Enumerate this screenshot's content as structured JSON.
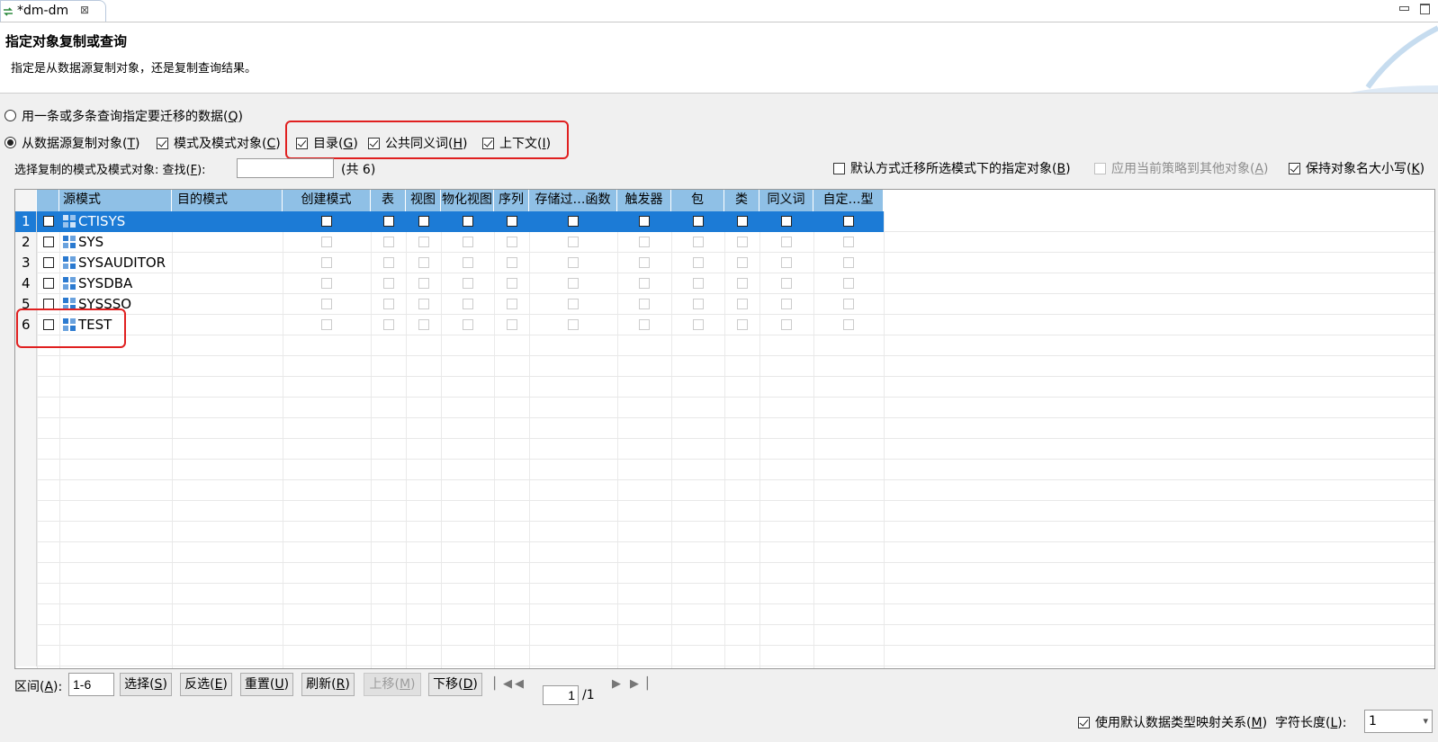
{
  "tab": {
    "title": "*dm-dm",
    "close_glyph": "⊠"
  },
  "header": {
    "title": "指定对象复制或查询",
    "description": "指定是从数据源复制对象，还是复制查询结果。"
  },
  "options": {
    "query_radio": {
      "pre": "用一条或多条查询指定要迁移的数据(",
      "key": "Q",
      "post": ")",
      "checked": false
    },
    "copy_radio": {
      "pre": "从数据源复制对象(",
      "key": "T",
      "post": ")",
      "checked": true
    },
    "schema_objects": {
      "pre": "模式及模式对象(",
      "key": "C",
      "post": ")",
      "checked": true
    },
    "catalog": {
      "pre": "目录(",
      "key": "G",
      "post": ")",
      "checked": true
    },
    "public_synonym": {
      "pre": "公共同义词(",
      "key": "H",
      "post": ")",
      "checked": true
    },
    "context": {
      "pre": "上下文(",
      "key": "I",
      "post": ")",
      "checked": true
    }
  },
  "select_row": {
    "label": "选择复制的模式及模式对象:",
    "find_pre": "查找(",
    "find_key": "F",
    "find_post": "):",
    "search_value": "",
    "count": "(共 6)",
    "default_migrate": {
      "pre": "默认方式迁移所选模式下的指定对象(",
      "key": "B",
      "post": ")",
      "checked": false
    },
    "apply_policy": {
      "pre": "应用当前策略到其他对象(",
      "key": "A",
      "post": ")",
      "checked": false,
      "disabled": true
    },
    "keep_case": {
      "pre": "保持对象名大小写(",
      "key": "K",
      "post": ")",
      "checked": true
    }
  },
  "grid": {
    "columns": [
      "源模式",
      "目的模式",
      "创建模式",
      "表",
      "视图",
      "物化视图",
      "序列",
      "存储过…函数",
      "触发器",
      "包",
      "类",
      "同义词",
      "自定…型"
    ],
    "rows": [
      {
        "num": "1",
        "schema": "CTISYS",
        "selected": true
      },
      {
        "num": "2",
        "schema": "SYS",
        "selected": false
      },
      {
        "num": "3",
        "schema": "SYSAUDITOR",
        "selected": false
      },
      {
        "num": "4",
        "schema": "SYSDBA",
        "selected": false
      },
      {
        "num": "5",
        "schema": "SYSSSO",
        "selected": false
      },
      {
        "num": "6",
        "schema": "TEST",
        "selected": false
      }
    ]
  },
  "bottom": {
    "range_pre": "区间(",
    "range_key": "A",
    "range_post": "):",
    "range_value": "1-6",
    "buttons": [
      {
        "pre": "选择(",
        "key": "S",
        "post": ")",
        "disabled": false
      },
      {
        "pre": "反选(",
        "key": "E",
        "post": ")",
        "disabled": false
      },
      {
        "pre": "重置(",
        "key": "U",
        "post": ")",
        "disabled": false
      },
      {
        "pre": "刷新(",
        "key": "R",
        "post": ")",
        "disabled": false
      },
      {
        "pre": "上移(",
        "key": "M",
        "post": ")",
        "disabled": true
      },
      {
        "pre": "下移(",
        "key": "D",
        "post": ")",
        "disabled": false
      }
    ],
    "page_value": "1",
    "page_total": "/1"
  },
  "footer": {
    "use_default_mapping": {
      "pre": "使用默认数据类型映射关系(",
      "key": "M",
      "post": ")",
      "checked": true
    },
    "char_length_pre": "字符长度(",
    "char_length_key": "L",
    "char_length_post": "):",
    "char_length_value": "1"
  },
  "colors": {
    "selection": "#1c7bd6",
    "header": "#8fc0e6",
    "highlight_box": "#e02020"
  }
}
